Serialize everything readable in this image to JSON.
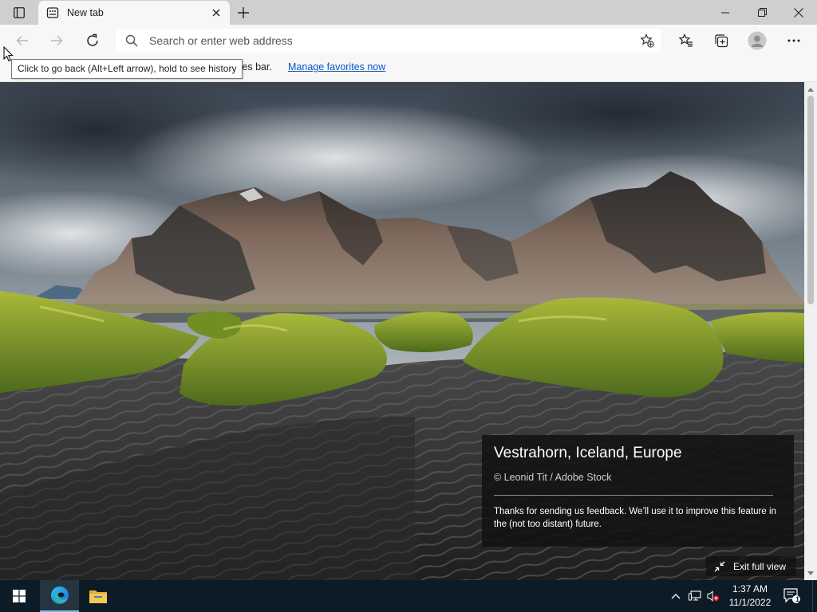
{
  "browser": {
    "tab_title": "New tab",
    "address_placeholder": "Search or enter web address",
    "back_tooltip": "Click to go back (Alt+Left arrow), hold to see history",
    "favorites_text": "rites bar.",
    "favorites_link": "Manage favorites now"
  },
  "background": {
    "location": "Vestrahorn, Iceland, Europe",
    "credit": "© Leonid Tit / Adobe Stock",
    "feedback": "Thanks for sending us feedback. We’ll use it to improve this feature in the (not too distant) future.",
    "exit_full_view": "Exit full view"
  },
  "taskbar": {
    "time": "1:37 AM",
    "date": "11/1/2022",
    "notification_count": "1"
  },
  "icons": {
    "tab_actions": "tab-actions-icon",
    "favicon": "new-tab-favicon",
    "back": "back-arrow-icon",
    "forward": "forward-arrow-icon",
    "refresh": "refresh-icon",
    "search": "search-icon",
    "add_favorite": "star-plus-icon",
    "favorites": "favorites-icon",
    "collections": "collections-icon",
    "profile": "profile-icon",
    "menu": "more-dots-icon",
    "start": "windows-start-icon",
    "edge": "edge-icon",
    "explorer": "folder-icon"
  },
  "colors": {
    "link": "#0b57c3",
    "taskbar": "#0c1b26",
    "tabstrip": "#cfcfcf",
    "toolbar": "#f7f7f7"
  }
}
